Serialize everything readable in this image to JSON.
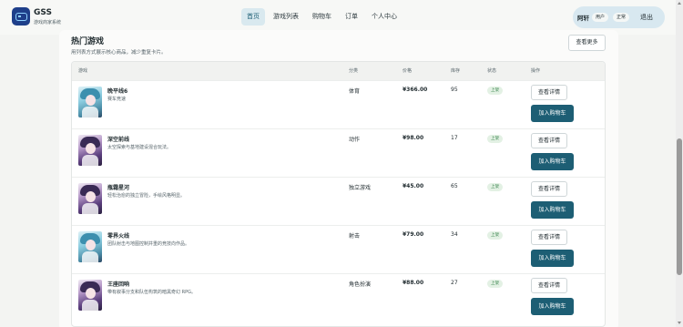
{
  "app": {
    "name": "GSS",
    "subtitle": "游戏商家系统"
  },
  "nav": {
    "items": [
      {
        "label": "首页",
        "active": true
      },
      {
        "label": "游戏列表",
        "active": false
      },
      {
        "label": "购物车",
        "active": false
      },
      {
        "label": "订单",
        "active": false
      },
      {
        "label": "个人中心",
        "active": false
      }
    ]
  },
  "user": {
    "name": "阿轩",
    "role": "用户",
    "status": "正常",
    "logout_label": "退出"
  },
  "section": {
    "title": "热门游戏",
    "subtitle": "用列表方式展示核心商品，减少重复卡片。",
    "more_label": "查看更多"
  },
  "table": {
    "headers": {
      "game": "游戏",
      "category": "分类",
      "price": "价格",
      "stock": "库存",
      "status": "状态",
      "actions": "操作"
    },
    "rows": [
      {
        "name": "晚平线6",
        "desc": "赛车竞速",
        "category": "体育",
        "price": "¥366.00",
        "stock": "95",
        "status": "上架",
        "detail_label": "查看详情",
        "cart_label": "加入购物车",
        "thumb": "cyan"
      },
      {
        "name": "深空前线",
        "desc": "太空探索与基地建设混合玩法。",
        "category": "动作",
        "price": "¥98.00",
        "stock": "17",
        "status": "上架",
        "detail_label": "查看详情",
        "cart_label": "加入购物车",
        "thumb": "purple"
      },
      {
        "name": "瓶霜星河",
        "desc": "轻松治愈的独立冒险，手绘风格明显。",
        "category": "独立游戏",
        "price": "¥45.00",
        "stock": "65",
        "status": "上架",
        "detail_label": "查看详情",
        "cart_label": "加入购物车",
        "thumb": "purple"
      },
      {
        "name": "零界火线",
        "desc": "团队射击与地图控制并重的竞技向作品。",
        "category": "射击",
        "price": "¥79.00",
        "stock": "34",
        "status": "上架",
        "detail_label": "查看详情",
        "cart_label": "加入购物车",
        "thumb": "cyan"
      },
      {
        "name": "王座回响",
        "desc": "带有叙事分支和队伍构筑的暗黑奇幻 RPG。",
        "category": "角色扮演",
        "price": "¥88.00",
        "stock": "27",
        "status": "上架",
        "detail_label": "查看详情",
        "cart_label": "加入购物车",
        "thumb": "purple"
      }
    ]
  },
  "colors": {
    "accent": "#1d5e74",
    "nav_active_bg": "#d9e9ef",
    "status_badge_bg": "#e3f1e4",
    "status_badge_text": "#2e7d43",
    "user_box_bg": "#d8e8f0"
  }
}
